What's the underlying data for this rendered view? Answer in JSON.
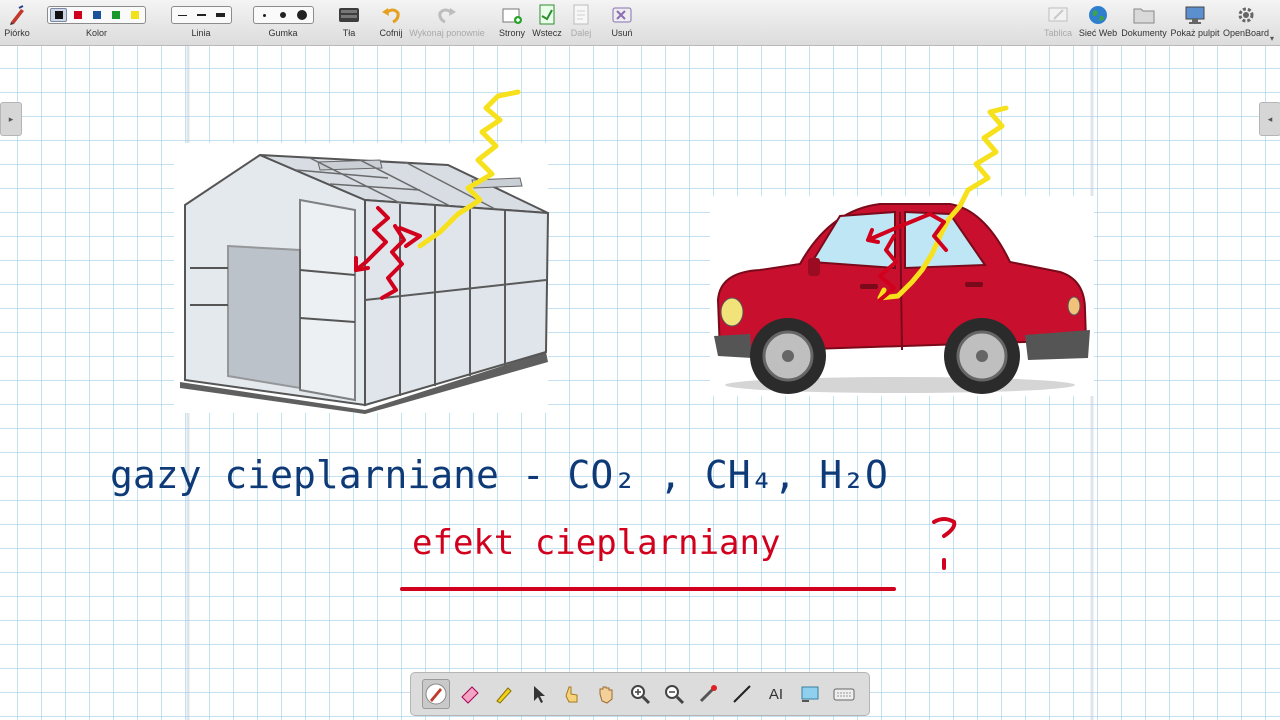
{
  "toolbar": {
    "pen_label": "Piórko",
    "color_label": "Kolor",
    "colors": [
      "#111111",
      "#d1001c",
      "#1c4f9c",
      "#1a9a2a",
      "#f2e21a"
    ],
    "line_label": "Linia",
    "eraser_label": "Gumka",
    "background_label": "Tła",
    "undo_label": "Cofnij",
    "redo_label": "Wykonaj ponownie",
    "pages_label": "Strony",
    "back_label": "Wstecz",
    "next_label": "Dalej",
    "delete_label": "Usuń",
    "board_label": "Tablica",
    "web_label": "Sieć Web",
    "documents_label": "Dokumenty",
    "desktop_label": "Pokaż pulpit",
    "openboard_label": "OpenBoard"
  },
  "board": {
    "line1": "gazy cieplarniane - CO₂ , CH₄, H₂O",
    "line2": "efekt cieplarniany"
  },
  "palette": {
    "tools": [
      "pen-tool",
      "eraser-tool",
      "marker-tool",
      "selector-tool",
      "interact-tool",
      "hand-tool",
      "zoom-in-tool",
      "zoom-out-tool",
      "laser-pointer-tool",
      "line-tool",
      "text-tool",
      "capture-tool",
      "keyboard-tool"
    ],
    "text_tool_glyph": "AI"
  },
  "colors": {
    "ink_blue": "#0e3b78",
    "ink_red": "#d1001c",
    "ink_yellow": "#f6e11c"
  }
}
